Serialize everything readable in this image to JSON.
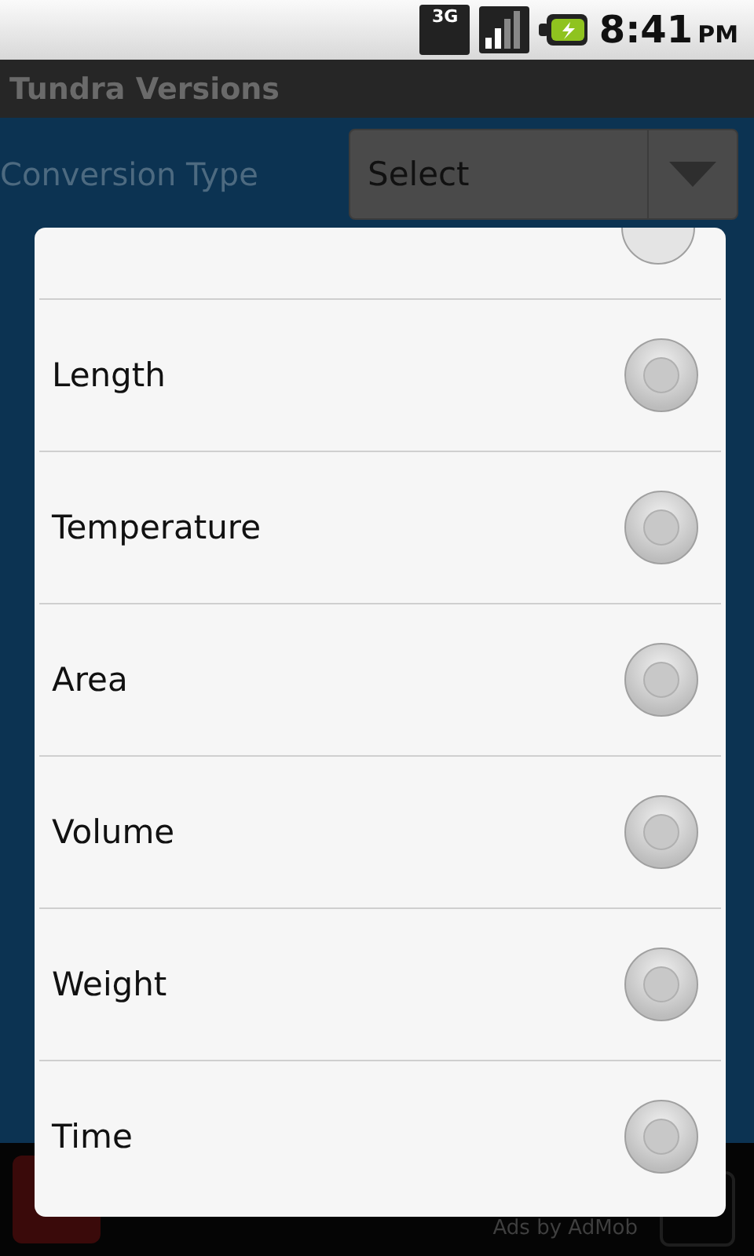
{
  "status_bar": {
    "network": "3G",
    "time": "8:41",
    "ampm": "PM"
  },
  "title_bar": {
    "title": "Tundra Versions"
  },
  "form": {
    "label": "Conversion Type",
    "spinner_value": "Select"
  },
  "dialog": {
    "items": [
      {
        "label": "Length",
        "selected": false
      },
      {
        "label": "Temperature",
        "selected": false
      },
      {
        "label": "Area",
        "selected": false
      },
      {
        "label": "Volume",
        "selected": false
      },
      {
        "label": "Weight",
        "selected": false
      },
      {
        "label": "Time",
        "selected": false
      }
    ]
  },
  "ad_bar": {
    "text": "Ads by AdMob"
  }
}
